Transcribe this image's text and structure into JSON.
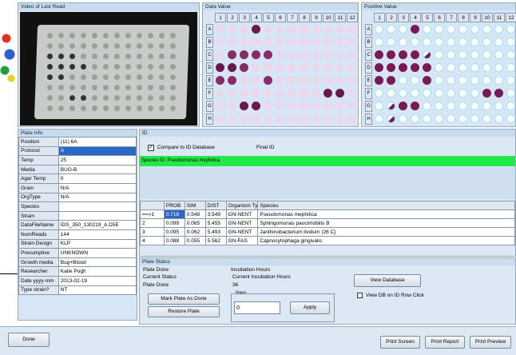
{
  "video": {
    "title": "Video of Last Read"
  },
  "data_value": {
    "title": "Data Value"
  },
  "positive_value": {
    "title": "Positive Value"
  },
  "columns": [
    "1",
    "2",
    "3",
    "4",
    "5",
    "6",
    "7",
    "8",
    "9",
    "10",
    "11",
    "12"
  ],
  "rows": [
    "A",
    "B",
    "C",
    "D",
    "E",
    "F",
    "G",
    "H"
  ],
  "plate_info": {
    "title": "Plate Info",
    "rows": [
      {
        "k": "Position",
        "v": "(11) 6A"
      },
      {
        "k": "Protocol",
        "v": "A"
      },
      {
        "k": "Temp",
        "v": "25"
      },
      {
        "k": "Media",
        "v": "BUG-B"
      },
      {
        "k": "Agar Temp",
        "v": "0"
      },
      {
        "k": "Gram",
        "v": "N/A"
      },
      {
        "k": "OrgType",
        "v": "N/A"
      },
      {
        "k": "Species",
        "v": ""
      },
      {
        "k": "Strain",
        "v": ""
      },
      {
        "k": "DataFileName",
        "v": "IDS_350_130219_A.D5E"
      },
      {
        "k": "NumReads",
        "v": "144"
      },
      {
        "k": "Strain Design",
        "v": "KLP"
      },
      {
        "k": "Presumptive",
        "v": "UNKNOWN"
      },
      {
        "k": "Growth media",
        "v": "Bug+Blood"
      },
      {
        "k": "Researcher",
        "v": "Katie Pugh"
      },
      {
        "k": "Date yyyy-mm",
        "v": "2013-02-19"
      },
      {
        "k": "Type strain?",
        "v": "NT"
      }
    ]
  },
  "id_panel": {
    "title": "ID",
    "compare_label": "Compare to ID Database",
    "final_id_label": "Final ID",
    "species_id": "Species ID: Pseudomonas mephitica"
  },
  "results": {
    "headers": [
      "",
      "PROB",
      "SIM",
      "DIST",
      "Organism Ty",
      "Species"
    ],
    "rows": [
      [
        "==>1",
        "0.718",
        "0.548",
        "3.549",
        "GN-NENT",
        "Pseudomonas mephitica"
      ],
      [
        "2",
        "0.099",
        "0.065",
        "5.455",
        "GN-NENT",
        "Sphingomonas paucimobilis B"
      ],
      [
        "3",
        "0.095",
        "0.062",
        "5.493",
        "GN-NENT",
        "Janthinobacterium lividum (26 C)"
      ],
      [
        "4",
        "0.088",
        "0.055",
        "5.562",
        "GN-FAS",
        "Capnocytophaga gingivalis"
      ]
    ]
  },
  "plate_status": {
    "title": "Plate Status",
    "plate_done": "Plate Done",
    "current_status_label": "Current Status",
    "current_status": "Plate Done",
    "incubation_hours": "Incubation Hours",
    "current_incubation_label": "Current Incubation Hours",
    "current_incubation": "36",
    "new_label": "New",
    "new_value": "0",
    "apply": "Apply",
    "mark_done": "Mark Plate As Done",
    "restore": "Restore Plate",
    "view_database": "View Database",
    "view_db_row": "View DB on ID Row Click"
  },
  "footer": {
    "done": "Done",
    "print_screen": "Print Screen",
    "print_report": "Print Report",
    "print_preview": "Print Preview"
  },
  "colors": {
    "accent_green": "#22e84a",
    "selected_blue": "#2a68c8"
  }
}
